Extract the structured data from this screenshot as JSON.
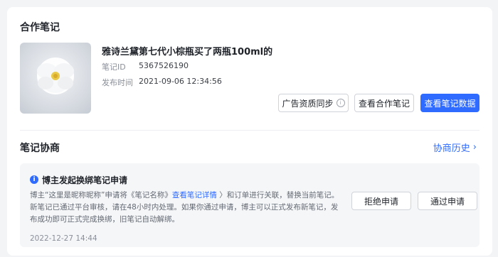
{
  "collab_note": {
    "section_title": "合作笔记",
    "title": "雅诗兰黛第七代小棕瓶买了两瓶100ml的",
    "id_label": "笔记ID",
    "id_value": "5367526190",
    "time_label": "发布时间",
    "time_value": "2021-09-06 12:34:56",
    "btn_sync": "广告资质同步",
    "btn_view_note": "查看合作笔记",
    "btn_view_data": "查看笔记数据"
  },
  "negotiation": {
    "section_title": "笔记协商",
    "history_link": "协商历史",
    "request": {
      "title": "博主发起换绑笔记申请",
      "text_before": "博主“这里是昵称昵称”申请将《笔记名称》",
      "link": "查看笔记详情",
      "text_after": " 〉和订单进行关联，替换当前笔记。新笔记已通过平台审核，请在48小时内处理。如果你通过申请，博主可以正式发布新笔记，发布成功即可正式完成换绑，旧笔记自动解绑。",
      "time": "2022-12-27 14:44",
      "btn_reject": "拒绝申请",
      "btn_approve": "通过申请"
    }
  },
  "colors": {
    "accent": "#2f6bff",
    "background": "#f3f4f6"
  },
  "icons": [
    "info-icon",
    "chevron-right-icon",
    "help-circle-icon",
    "flower-image"
  ]
}
